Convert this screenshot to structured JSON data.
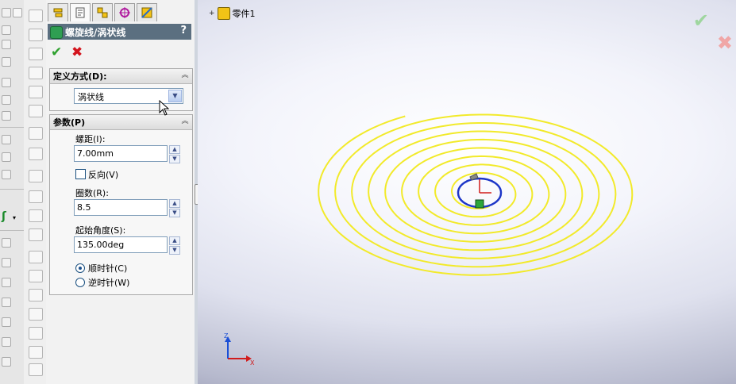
{
  "property_manager": {
    "title": "螺旋线/涡状线",
    "help": "?",
    "ok_mark": "✔",
    "cancel_mark": "✖",
    "tabs": [
      "feature-manager",
      "property-manager",
      "configuration-manager",
      "dimxpert-manager",
      "display-manager"
    ],
    "definition": {
      "heading": "定义方式(D):",
      "selected": "涡状线"
    },
    "parameters": {
      "heading": "参数(P)",
      "pitch_label": "螺距(I):",
      "pitch_value": "7.00mm",
      "reverse_label": "反向(V)",
      "turns_label": "圈数(R):",
      "turns_value": "8.5",
      "start_angle_label": "起始角度(S):",
      "start_angle_value": "135.00deg",
      "clockwise_label": "顺时针(C)",
      "counterclockwise_label": "逆时针(W)"
    }
  },
  "viewport": {
    "tree_root": "零件1",
    "confirm_ok": "✔",
    "confirm_cancel": "✖",
    "triad_z": "Z",
    "triad_x": "X"
  },
  "colors": {
    "spiral": "#f2ea2a",
    "circle": "#1d36c8",
    "header": "#5b6f80"
  }
}
